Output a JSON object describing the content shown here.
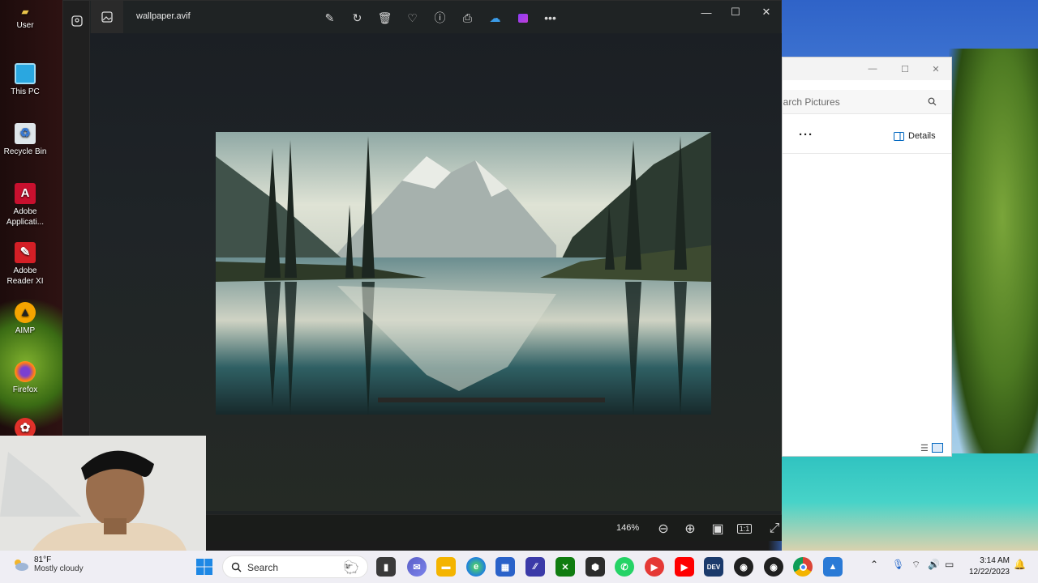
{
  "desktop": {
    "icons": [
      {
        "label": "User"
      },
      {
        "label": "This PC"
      },
      {
        "label": "Recycle Bin"
      },
      {
        "label": "Adobe Applicati..."
      },
      {
        "label": "Adobe Reader XI"
      },
      {
        "label": "AIMP"
      },
      {
        "label": "Firefox"
      }
    ]
  },
  "photos": {
    "filename": "wallpaper.avif",
    "toolbar": [
      "edit-image-icon",
      "rotate-icon",
      "delete-icon",
      "favorite-icon",
      "info-icon",
      "print-icon",
      "onedrive-icon",
      "clipchamp-icon",
      "more-icon"
    ],
    "zoom": "146%",
    "footer_buttons": [
      "zoom-out-icon",
      "zoom-in-icon",
      "fit-window-icon",
      "actual-size-icon",
      "fullscreen-icon"
    ]
  },
  "explorer": {
    "search_placeholder": "earch Pictures",
    "more_label": "···",
    "details_label": "Details"
  },
  "taskbar": {
    "weather_temp": "81°F",
    "weather_desc": "Mostly cloudy",
    "search_label": "Search",
    "time": "3:14 AM",
    "date": "12/22/2023",
    "colors": {
      "accent": "#0067c0",
      "bg": "#efeef4"
    }
  }
}
